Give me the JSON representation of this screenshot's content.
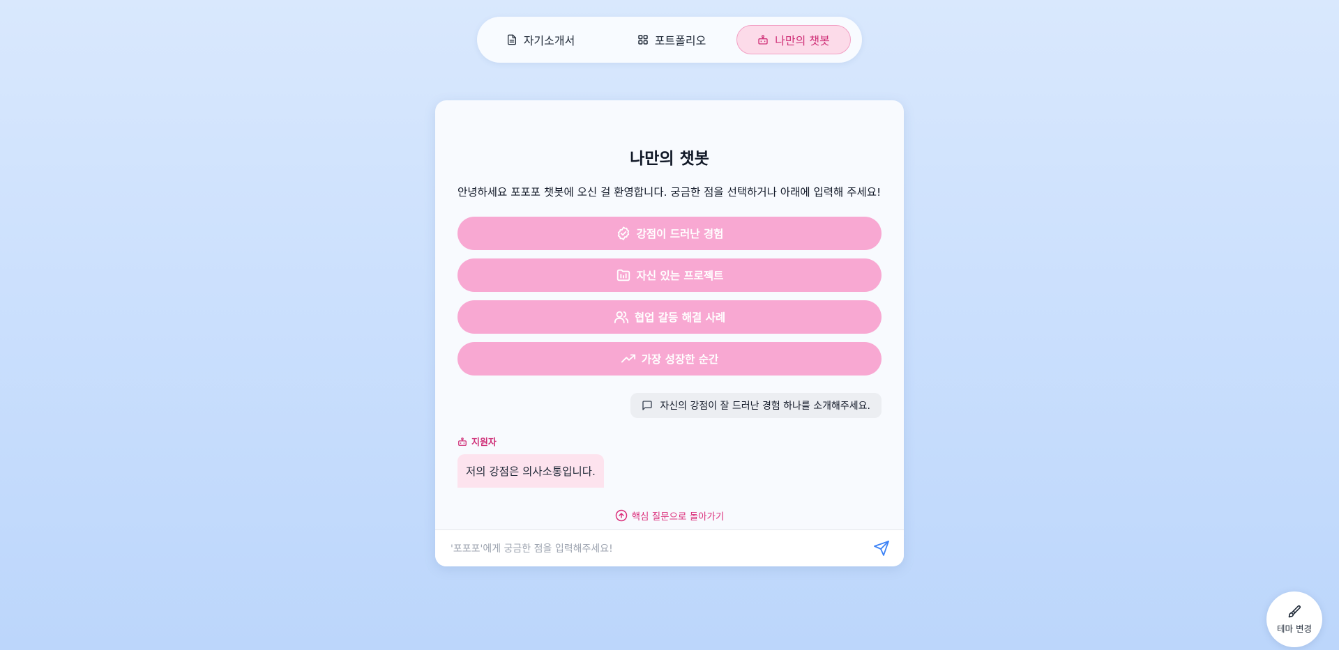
{
  "nav": {
    "tabs": [
      {
        "label": "자기소개서",
        "icon": "document-icon"
      },
      {
        "label": "포트폴리오",
        "icon": "grid-icon"
      },
      {
        "label": "나만의 챗봇",
        "icon": "bot-icon",
        "active": true
      }
    ]
  },
  "chat": {
    "title": "나만의 챗봇",
    "intro": "안녕하세요 포포포 챗봇에 오신 걸 환영합니다. 궁금한 점을 선택하거나 아래에 입력해 주세요!",
    "quick_questions": [
      {
        "label": "강점이 드러난 경험",
        "icon": "check-circle-icon"
      },
      {
        "label": "자신 있는 프로젝트",
        "icon": "folder-chart-icon"
      },
      {
        "label": "협업 갈등 해결 사례",
        "icon": "users-icon"
      },
      {
        "label": "가장 성장한 순간",
        "icon": "trending-up-icon"
      }
    ],
    "messages": {
      "user": "자신의 강점이 잘 드러난 경험 하나를 소개해주세요.",
      "bot_name": "지원자",
      "bot": "저의 강점은 의사소통입니다."
    },
    "back_link": "핵심 질문으로 돌아가기",
    "input_placeholder": "'포포포'에게 궁금한 점을 입력해주세요!"
  },
  "theme": {
    "label": "테마 변경",
    "icon": "brush-icon"
  },
  "colors": {
    "accent": "#db2f7b",
    "quick_button": "#f8a8d2",
    "active_tab_bg": "#fcdbe9",
    "bot_bubble": "#fde3ee",
    "user_bubble": "#eceef2",
    "send_icon": "#3b82f6"
  }
}
